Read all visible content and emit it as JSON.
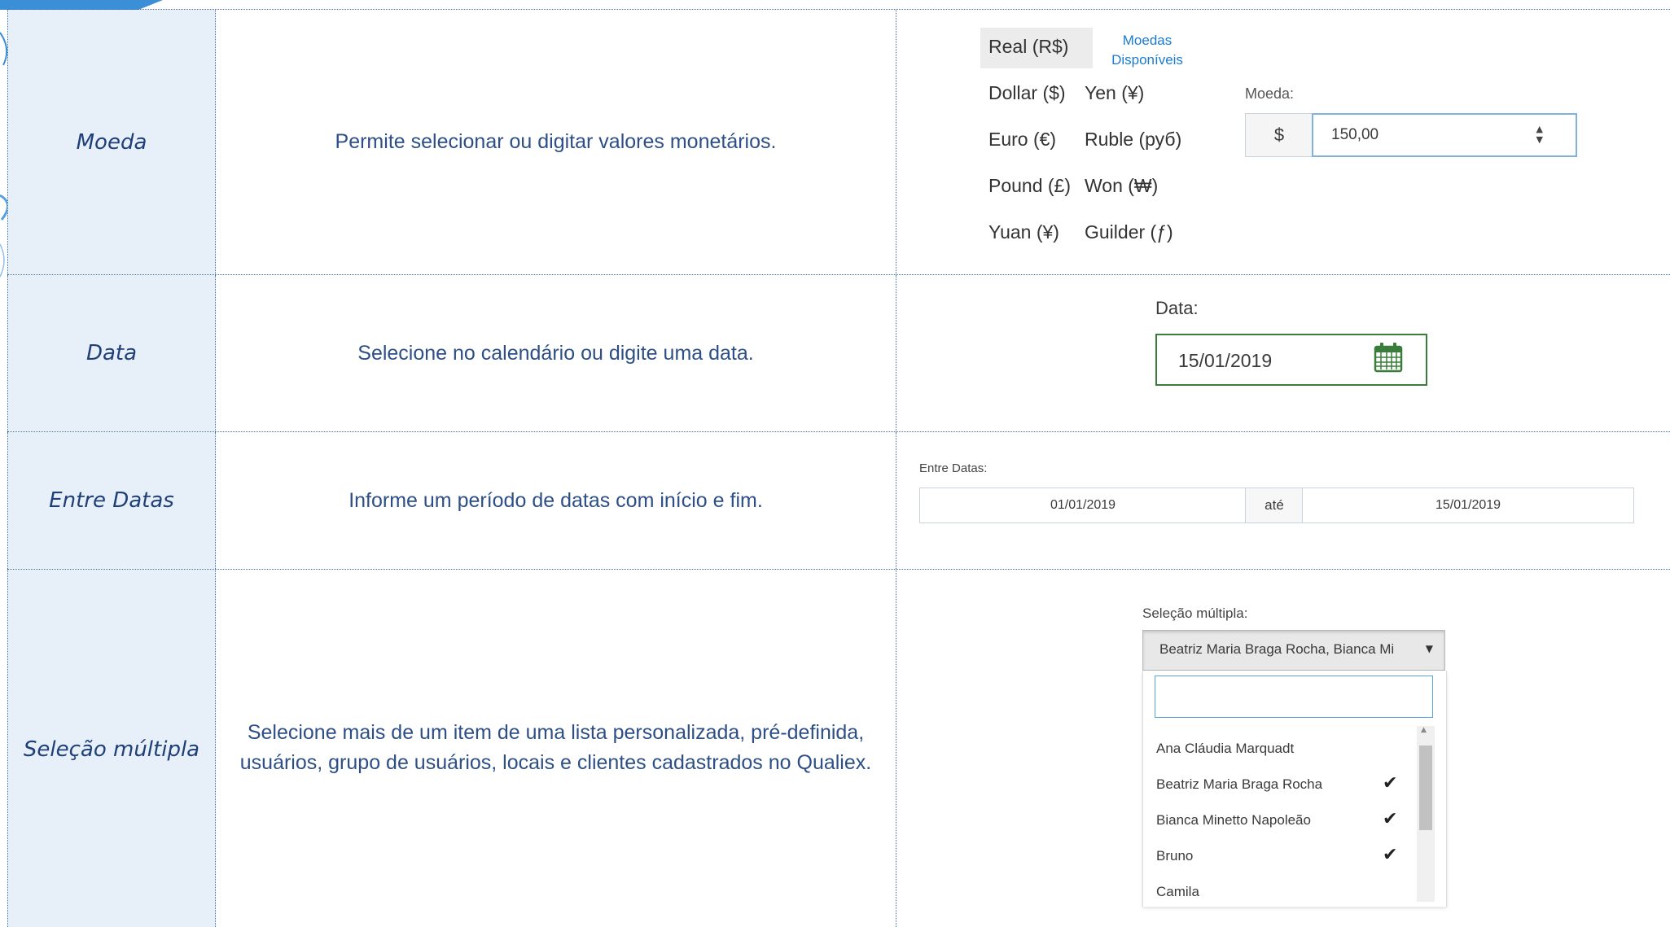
{
  "rows": [
    {
      "name": "Moeda",
      "description": "Permite selecionar ou digitar valores monetários.",
      "example": {
        "selected_currency": "Real (R$)",
        "available_link": "Moedas Disponíveis",
        "currencies": [
          "Dollar ($)",
          "Yen (¥)",
          "Euro (€)",
          "Ruble (руб)",
          "Pound (£)",
          "Won (₩)",
          "Yuan (¥)",
          "Guilder (ƒ)"
        ],
        "field_label": "Moeda:",
        "symbol": "$",
        "value": "150,00"
      }
    },
    {
      "name": "Data",
      "description": "Selecione no calendário ou digite uma data.",
      "example": {
        "field_label": "Data:",
        "value": "15/01/2019"
      }
    },
    {
      "name": "Entre Datas",
      "description": "Informe um período de datas com início e fim.",
      "example": {
        "field_label": "Entre Datas:",
        "start": "01/01/2019",
        "separator": "até",
        "end": "15/01/2019"
      }
    },
    {
      "name": "Seleção múltipla",
      "description_line1": "Selecione mais de um item de uma lista personalizada, pré-definida,",
      "description_line2": "usuários, grupo de usuários, locais e clientes cadastrados no Qualiex.",
      "example": {
        "field_label": "Seleção múltipla:",
        "selected_text": "Beatriz Maria Braga Rocha, Bianca Mi",
        "search_value": "",
        "options": [
          {
            "label": "Ana Cláudia Marquadt",
            "checked": false
          },
          {
            "label": "Beatriz Maria Braga Rocha",
            "checked": true
          },
          {
            "label": "Bianca Minetto Napoleão",
            "checked": true
          },
          {
            "label": "Bruno",
            "checked": true
          },
          {
            "label": "Camila",
            "checked": false
          }
        ]
      }
    }
  ],
  "colors": {
    "grid": "#3d6ea8",
    "name_bg": "#e7eff9",
    "text": "#2d4f86",
    "date_border": "#3a7d3a",
    "link": "#1a7bd0"
  }
}
